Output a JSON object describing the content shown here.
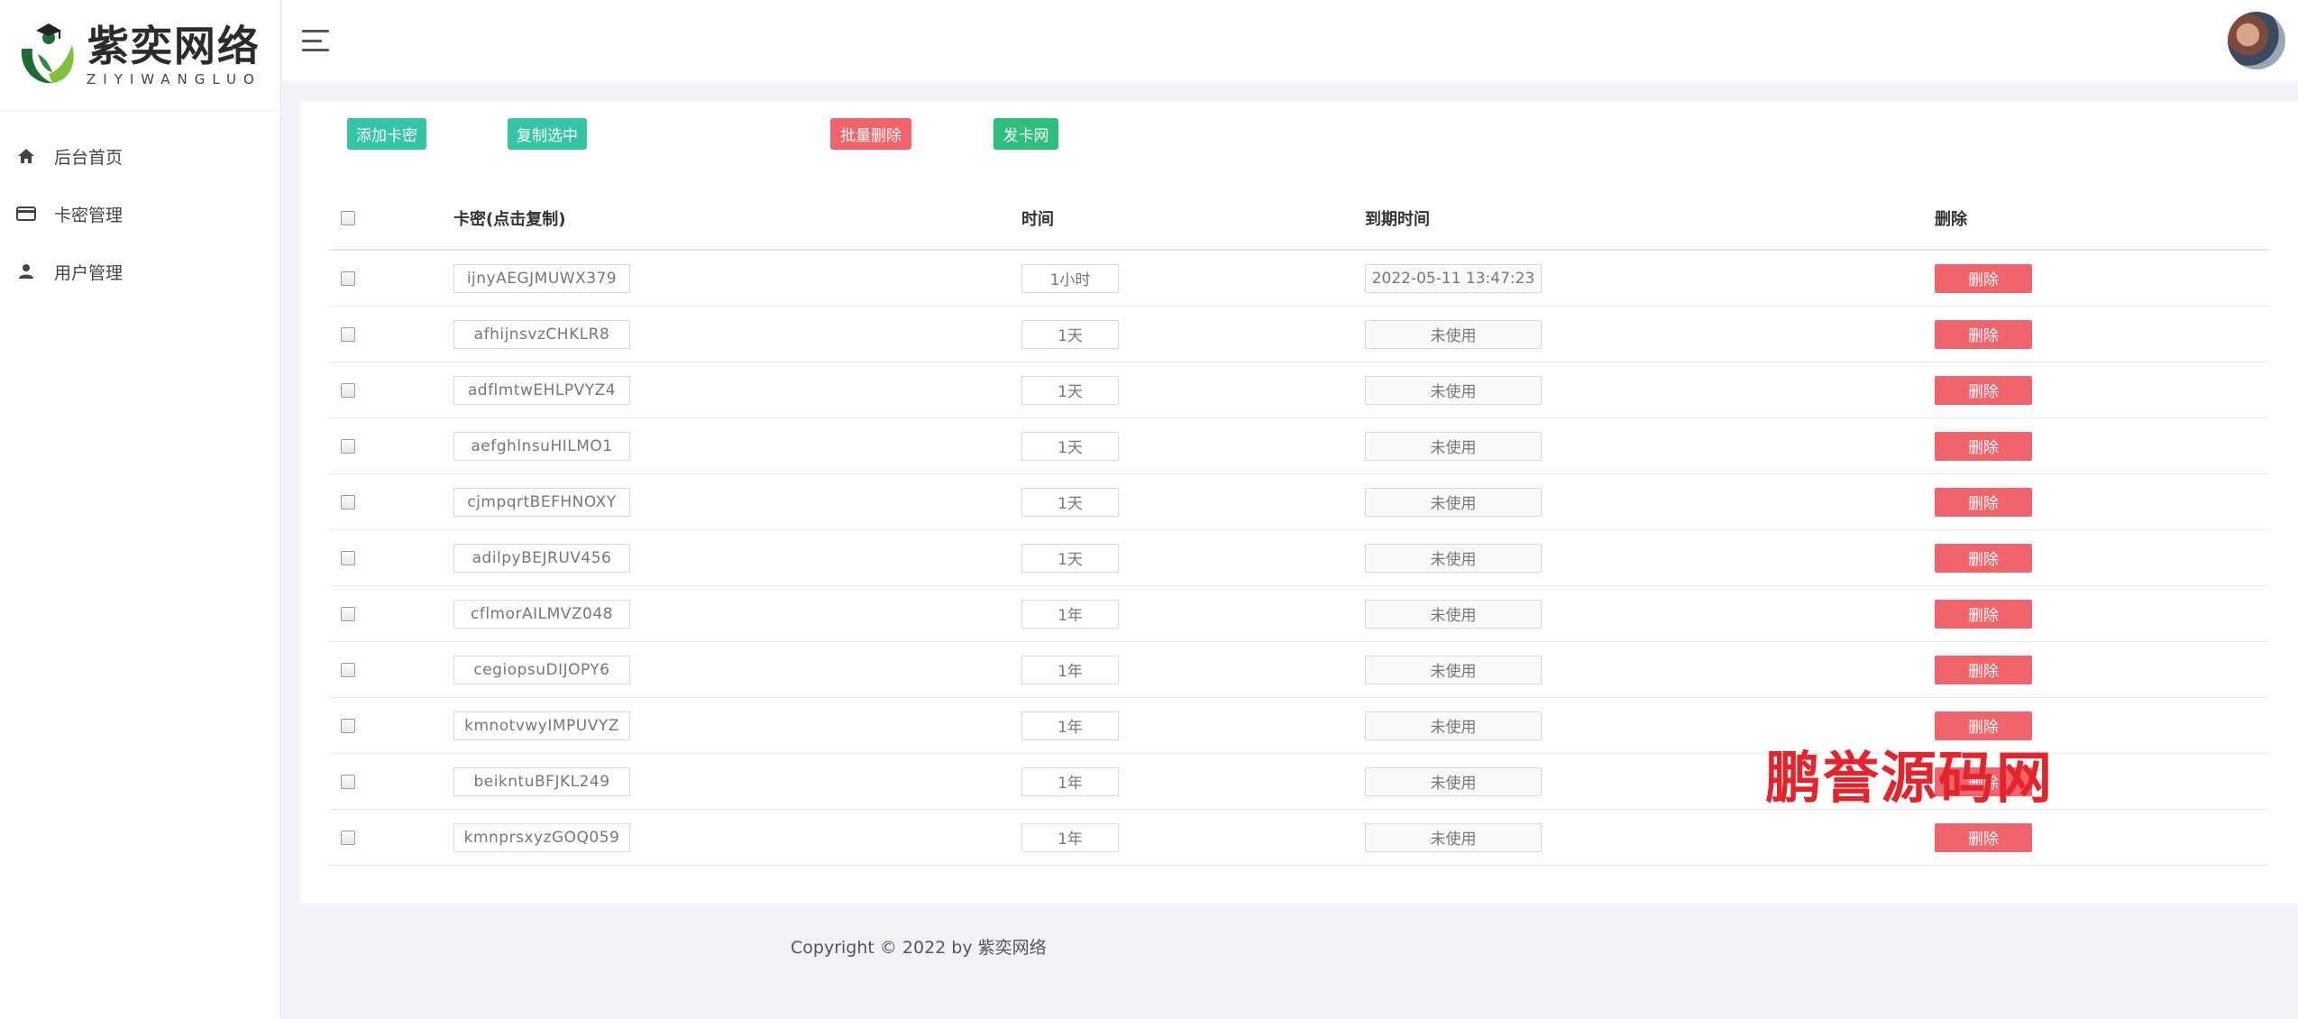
{
  "brand": {
    "title": "紫奕网络",
    "subtitle": "ZIYIWANGLUO",
    "colors": {
      "leaf_dark": "#1f6b34",
      "leaf_light": "#7fbf3a"
    }
  },
  "sidebar": {
    "items": [
      {
        "label": "后台首页",
        "icon": "home-icon"
      },
      {
        "label": "卡密管理",
        "icon": "card-icon"
      },
      {
        "label": "用户管理",
        "icon": "user-icon"
      }
    ]
  },
  "toolbar": {
    "add_label": "添加卡密",
    "copy_label": "复制选中",
    "batch_delete_label": "批量删除",
    "shop_label": "发卡网"
  },
  "table": {
    "headers": {
      "key": "卡密(点击复制)",
      "time": "时间",
      "expire": "到期时间",
      "delete": "删除"
    },
    "delete_label": "删除",
    "rows": [
      {
        "key": "ijnyAEGJMUWX379",
        "time": "1小时",
        "expire": "2022-05-11 13:47:23"
      },
      {
        "key": "afhijnsvzCHKLR8",
        "time": "1天",
        "expire": "未使用"
      },
      {
        "key": "adflmtwEHLPVYZ4",
        "time": "1天",
        "expire": "未使用"
      },
      {
        "key": "aefghlnsuHILMO1",
        "time": "1天",
        "expire": "未使用"
      },
      {
        "key": "cjmpqrtBEFHNOXY",
        "time": "1天",
        "expire": "未使用"
      },
      {
        "key": "adilpyBEJRUV456",
        "time": "1天",
        "expire": "未使用"
      },
      {
        "key": "cflmorAILMVZ048",
        "time": "1年",
        "expire": "未使用"
      },
      {
        "key": "cegiopsuDIJOPY6",
        "time": "1年",
        "expire": "未使用"
      },
      {
        "key": "kmnotvwyIMPUVYZ",
        "time": "1年",
        "expire": "未使用"
      },
      {
        "key": "beikntuBFJKL249",
        "time": "1年",
        "expire": "未使用"
      },
      {
        "key": "kmnprsxyzGOQ059",
        "time": "1年",
        "expire": "未使用"
      }
    ]
  },
  "watermark": "鹏誉源码网",
  "footer": "Copyright © 2022 by 紫奕网络",
  "colors": {
    "teal": "#34c6a4",
    "green": "#2fbf7d",
    "red": "#f1646c"
  }
}
